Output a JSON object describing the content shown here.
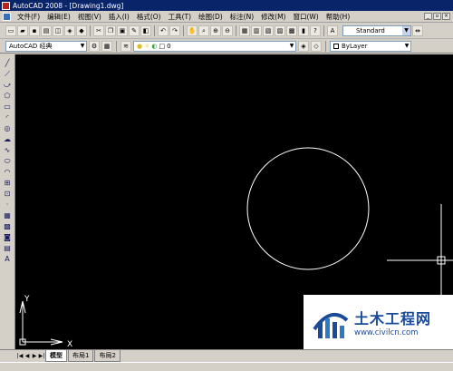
{
  "window": {
    "title": "AutoCAD 2008 - [Drawing1.dwg]"
  },
  "menu": [
    "文件(F)",
    "编辑(E)",
    "视图(V)",
    "插入(I)",
    "格式(O)",
    "工具(T)",
    "绘图(D)",
    "标注(N)",
    "修改(M)",
    "窗口(W)",
    "帮助(H)"
  ],
  "toolbar": {
    "text_style": "Standard"
  },
  "workspace": {
    "name": "AutoCAD 经典"
  },
  "layer": {
    "name": "0"
  },
  "color_control": {
    "value": "ByLayer"
  },
  "ucs": {
    "x_label": "X",
    "y_label": "Y"
  },
  "tabs": [
    "模型",
    "布局1",
    "布局2"
  ],
  "watermark": {
    "title": "土木工程网",
    "url": "www.civilcn.com"
  },
  "colors": {
    "canvas": "#000000",
    "title_bar": "#0a246a",
    "geometry": "#ffffff",
    "watermark_text": "#1a4a9a"
  }
}
